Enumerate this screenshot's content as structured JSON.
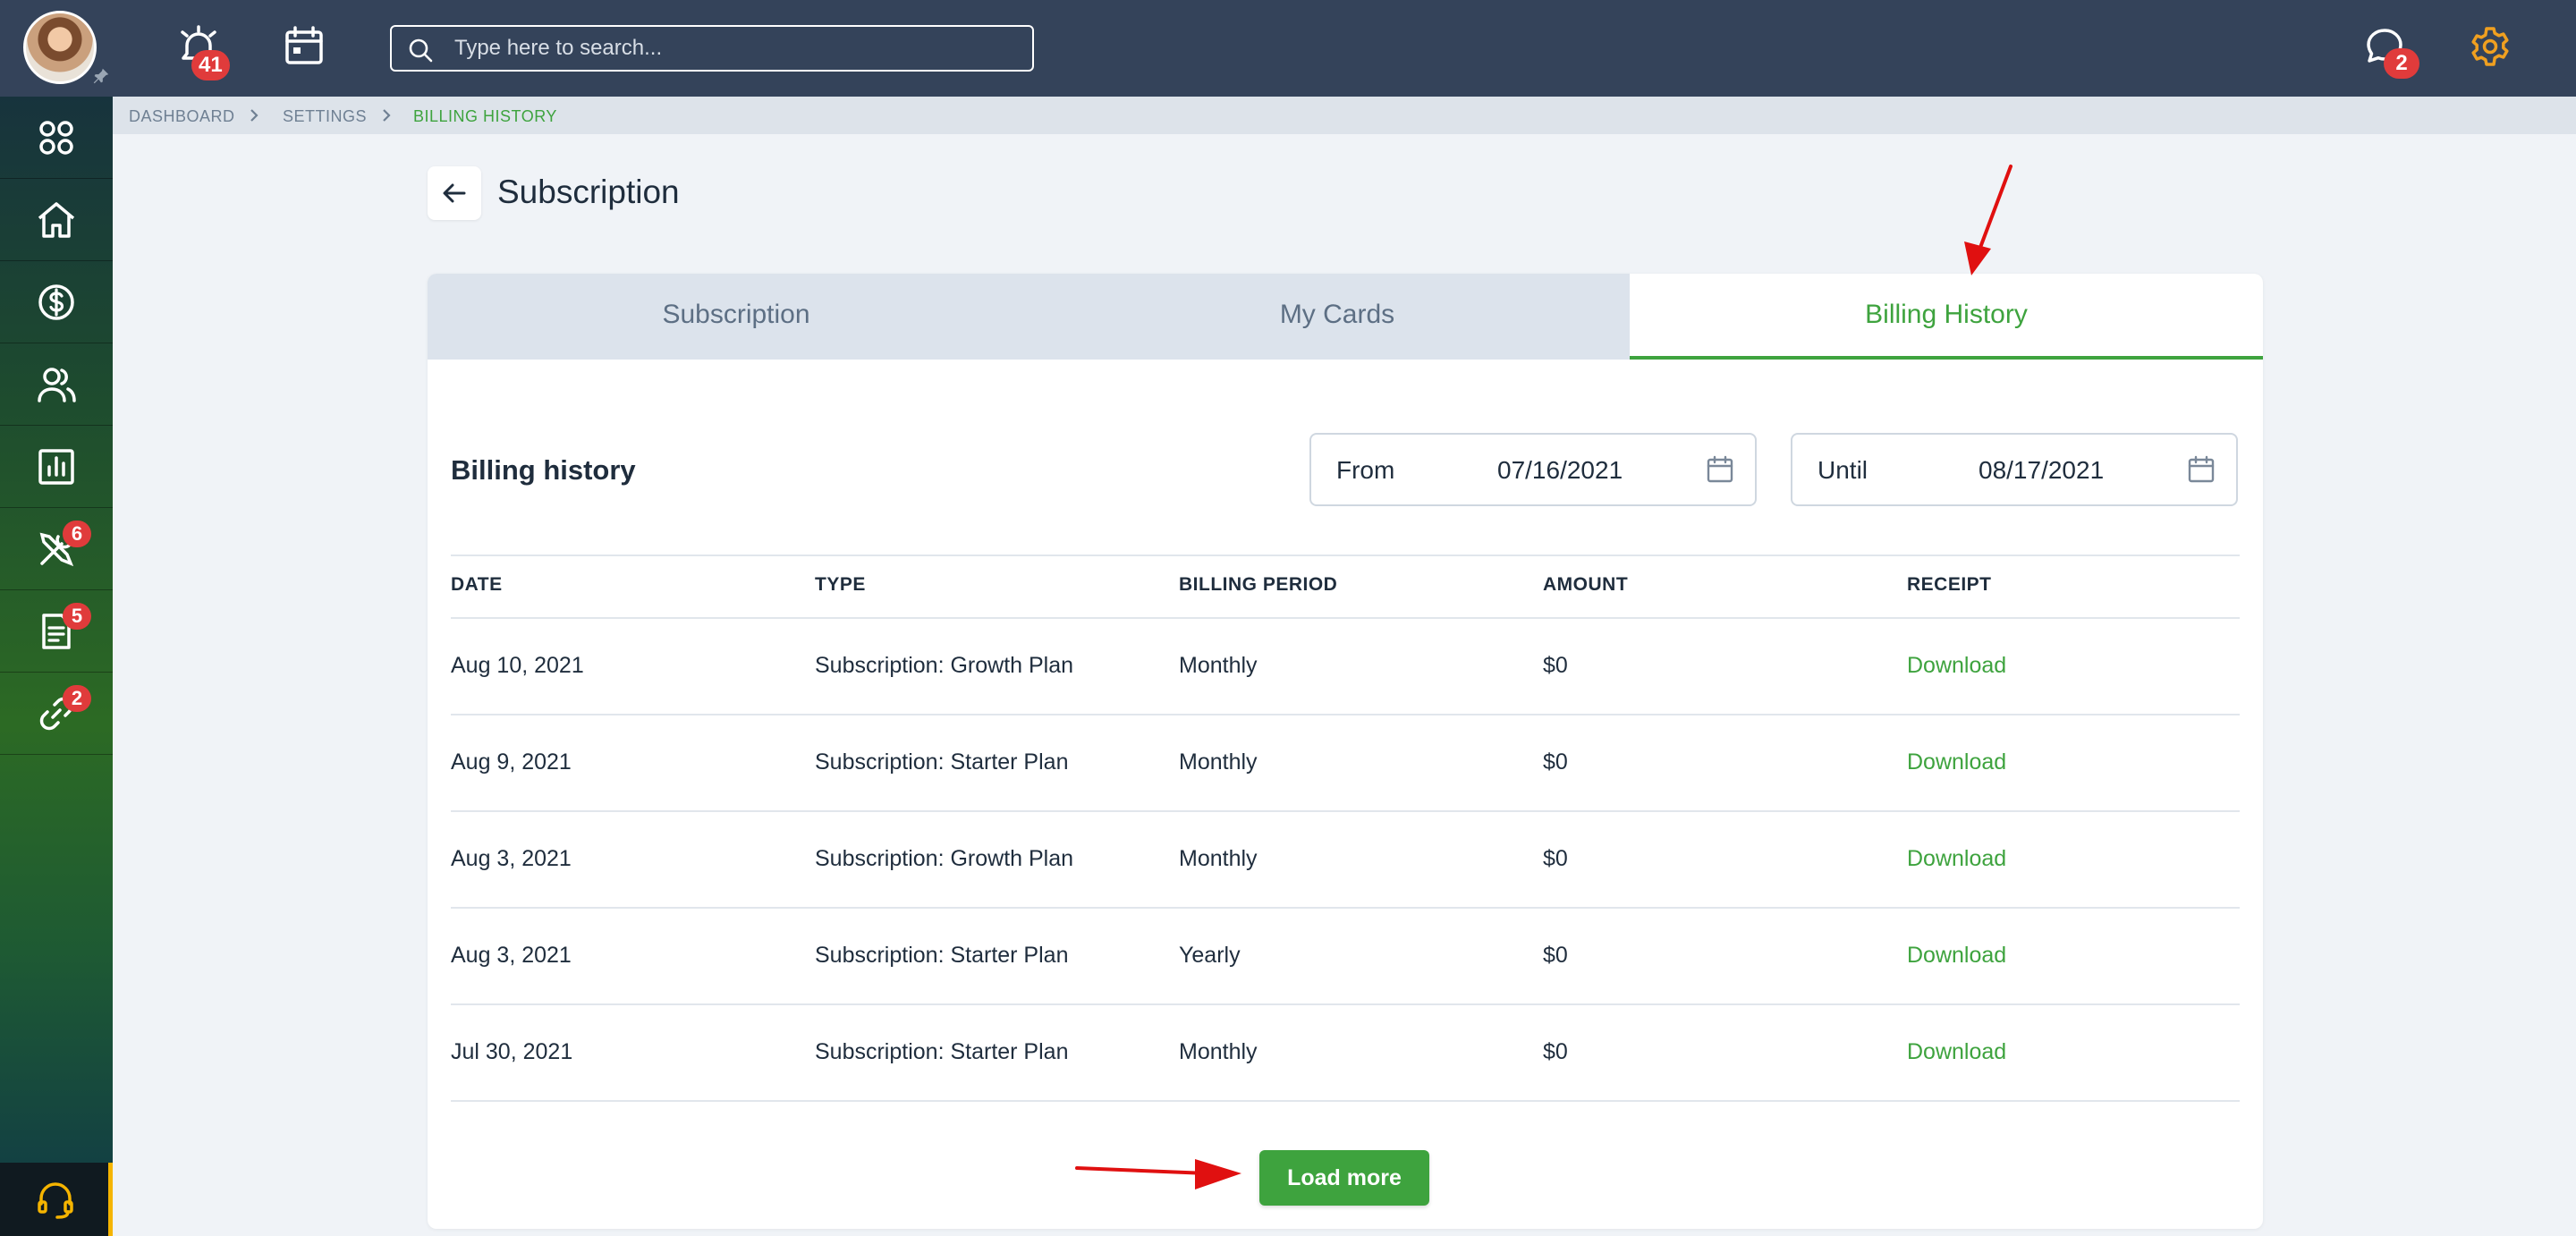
{
  "header": {
    "notifications_count": "41",
    "search_placeholder": "Type here to search...",
    "messages_count": "2"
  },
  "sidebar": {
    "items": [
      {
        "icon": "apps-grid-icon",
        "badge": ""
      },
      {
        "icon": "home-icon",
        "badge": ""
      },
      {
        "icon": "dollar-circle-icon",
        "badge": ""
      },
      {
        "icon": "users-icon",
        "badge": ""
      },
      {
        "icon": "chart-icon",
        "badge": ""
      },
      {
        "icon": "tools-icon",
        "badge": "6"
      },
      {
        "icon": "document-icon",
        "badge": "5"
      },
      {
        "icon": "link-icon",
        "badge": "2"
      }
    ],
    "support_icon": "headset-icon"
  },
  "breadcrumb": {
    "items": [
      "DASHBOARD",
      "SETTINGS",
      "BILLING HISTORY"
    ]
  },
  "page": {
    "title": "Subscription"
  },
  "tabs": [
    {
      "label": "Subscription",
      "active": false
    },
    {
      "label": "My Cards",
      "active": false
    },
    {
      "label": "Billing History",
      "active": true
    }
  ],
  "billing": {
    "title": "Billing history",
    "from_label": "From",
    "from_value": "07/16/2021",
    "until_label": "Until",
    "until_value": "08/17/2021",
    "columns": [
      "DATE",
      "TYPE",
      "BILLING PERIOD",
      "AMOUNT",
      "RECEIPT"
    ],
    "rows": [
      {
        "date": "Aug 10, 2021",
        "type": "Subscription: Growth Plan",
        "period": "Monthly",
        "amount": "$0",
        "receipt": "Download"
      },
      {
        "date": "Aug 9, 2021",
        "type": "Subscription: Starter Plan",
        "period": "Monthly",
        "amount": "$0",
        "receipt": "Download"
      },
      {
        "date": "Aug 3, 2021",
        "type": "Subscription: Growth Plan",
        "period": "Monthly",
        "amount": "$0",
        "receipt": "Download"
      },
      {
        "date": "Aug 3, 2021",
        "type": "Subscription: Starter Plan",
        "period": "Yearly",
        "amount": "$0",
        "receipt": "Download"
      },
      {
        "date": "Jul 30, 2021",
        "type": "Subscription: Starter Plan",
        "period": "Monthly",
        "amount": "$0",
        "receipt": "Download"
      }
    ],
    "load_more_label": "Load more"
  },
  "colors": {
    "accent_green": "#3ea33e",
    "topbar": "#34435a",
    "badge_red": "#e03b3b",
    "annotation_red": "#e01010",
    "settings_orange": "#f0a020"
  }
}
